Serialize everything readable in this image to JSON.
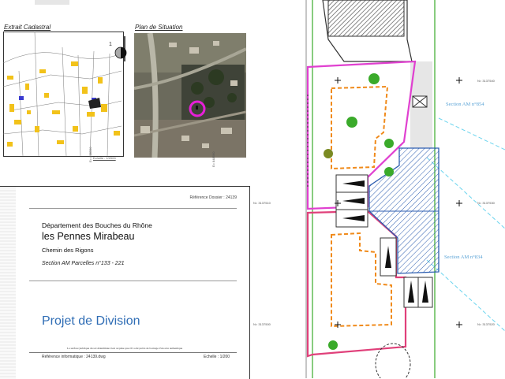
{
  "header": {
    "extrait_title": "Extrait Cadastral",
    "plan_title": "Plan de Situation",
    "echelle_small": "Echelle : 1/2000"
  },
  "cartouche": {
    "reference_dossier": "Référence Dossier : 24139",
    "departement": "Département des Bouches du Rhône",
    "commune": "les Pennes Mirabeau",
    "chemin": "Chemin des Rigons",
    "section": "Section AM Parcelles n°133 - 221",
    "projet": "Projet de Division",
    "legal_note": "La surface juridique du sol déterminée n'est acquise que s'il a été prévu de bornage d'un acte authentique",
    "reference_info": "Référence informatique : 24139.dwg",
    "echelle": "Echelle : 1/200"
  },
  "plan": {
    "section_am_854": "Section AM n°854",
    "section_am_834": "Section AM n°834",
    "coord_1": "N= 3137540",
    "coord_2": "N= 3137530",
    "coord_3": "N= 3137520",
    "coord_4": "N= 3137510",
    "coord_5": "N= 3137500",
    "coord_e1": "E= 848550",
    "coord_e2": "E= 848560"
  },
  "colors": {
    "magenta": "#e040d0",
    "pink": "#e0407a",
    "orange": "#f08a1a",
    "blue_hatch": "#2c5db0",
    "cyan": "#6ad4ee",
    "green": "#3aaa2a"
  }
}
